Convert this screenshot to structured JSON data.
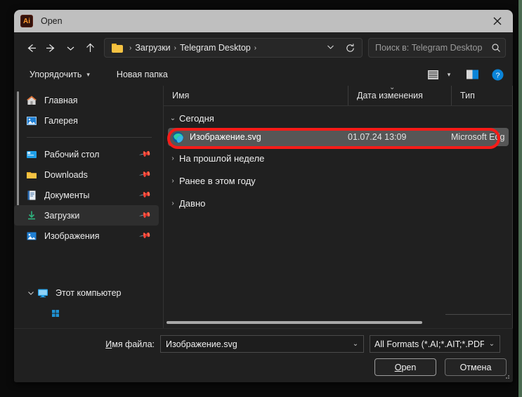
{
  "window": {
    "title": "Open",
    "app_icon": "Ai",
    "close_label": "×"
  },
  "nav": {
    "back_icon": "arrow-left-icon",
    "forward_icon": "arrow-right-icon",
    "recent_icon": "chevron-down-icon",
    "up_icon": "arrow-up-icon",
    "refresh_icon": "refresh-icon",
    "breadcrumb": {
      "folder_icon": "folder-icon",
      "sep": "›",
      "items": [
        "Загрузки",
        "Telegram Desktop"
      ],
      "trailing_sep": "›",
      "dropdown_icon": "chevron-down-icon"
    },
    "search": {
      "placeholder": "Поиск в: Telegram Desktop",
      "icon": "search-icon"
    }
  },
  "commandbar": {
    "organize_label": "Упорядочить",
    "organize_caret": "▾",
    "new_folder_label": "Новая папка",
    "view_icon": "list-view-icon",
    "view_caret": "▾",
    "preview_pane_icon": "preview-pane-icon",
    "help_icon": "help-icon",
    "help_glyph": "?"
  },
  "sidebar": {
    "quick_items": [
      {
        "label": "Главная",
        "icon": "home-icon",
        "pinned": false,
        "selected": false
      },
      {
        "label": "Галерея",
        "icon": "gallery-icon",
        "pinned": false,
        "selected": false
      }
    ],
    "pinned_items": [
      {
        "label": "Рабочий стол",
        "icon": "desktop-icon",
        "pinned": true,
        "selected": false
      },
      {
        "label": "Downloads",
        "icon": "folder-icon",
        "pinned": true,
        "selected": false
      },
      {
        "label": "Документы",
        "icon": "documents-icon",
        "pinned": true,
        "selected": false
      },
      {
        "label": "Загрузки",
        "icon": "downloads-icon",
        "pinned": true,
        "selected": true
      },
      {
        "label": "Изображения",
        "icon": "pictures-icon",
        "pinned": true,
        "selected": false
      }
    ],
    "tree_items": [
      {
        "label": "Этот компьютер",
        "icon": "this-pc-icon",
        "caret": "⌄",
        "expanded": true
      }
    ],
    "pin_glyph": "📌"
  },
  "filelist": {
    "columns": [
      {
        "key": "name",
        "label": "Имя"
      },
      {
        "key": "date",
        "label": "Дата изменения"
      },
      {
        "key": "type",
        "label": "Тип"
      }
    ],
    "sort_caret": "⌄",
    "groups": [
      {
        "label": "Сегодня",
        "caret": "⌄",
        "expanded": true,
        "rows": [
          {
            "name": "Изображение.svg",
            "date": "01.07.24 13:09",
            "type": "Microsoft Edg",
            "icon": "edge-icon",
            "selected": true,
            "annotated": true
          }
        ]
      },
      {
        "label": "На прошлой неделе",
        "caret": "›",
        "expanded": false,
        "rows": []
      },
      {
        "label": "Ранее в этом году",
        "caret": "›",
        "expanded": false,
        "rows": []
      },
      {
        "label": "Давно",
        "caret": "›",
        "expanded": false,
        "rows": []
      }
    ]
  },
  "footer": {
    "filename_label_prefix": "И",
    "filename_label_rest": "мя файла:",
    "filename_value": "Изображение.svg",
    "filename_caret": "⌄",
    "filter_value": "All Formats (*.AI;*.AIT;*.PDF;*.D",
    "filter_caret": "⌄",
    "open_prefix": "O",
    "open_rest": "pen",
    "cancel_label": "Отмена"
  },
  "colors": {
    "accent_red": "#f61b18",
    "titlebar": "#bfbfbf",
    "window_bg": "#202020",
    "selection": "#565656",
    "help_blue": "#0a84d8",
    "folder_yellow": "#f5c242"
  }
}
